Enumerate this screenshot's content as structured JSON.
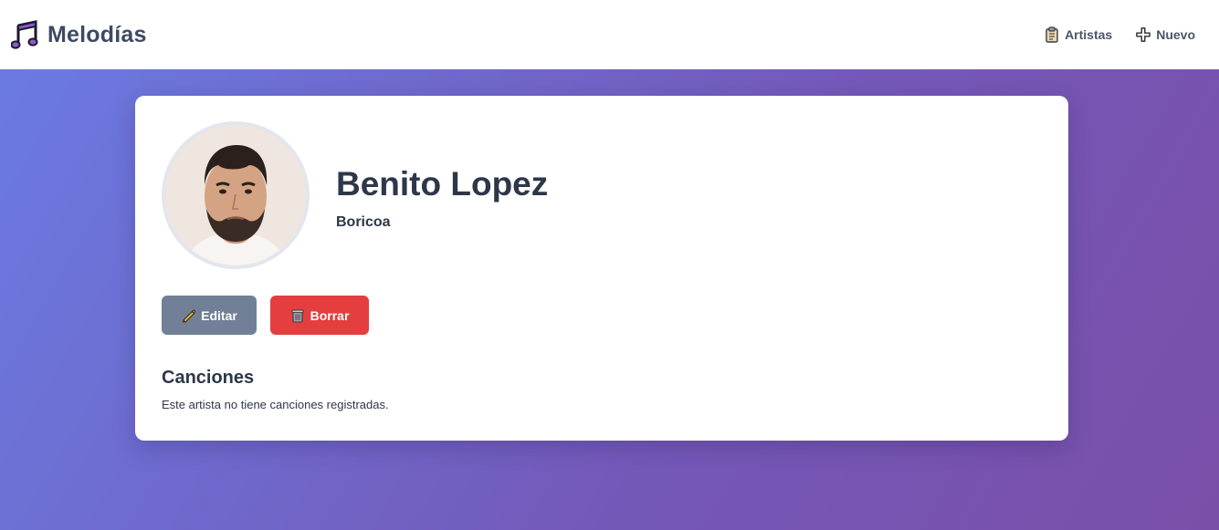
{
  "header": {
    "brand": "Melodías",
    "brand_icon": "music-notes-icon",
    "nav": [
      {
        "label": "Artistas",
        "icon": "clipboard-icon"
      },
      {
        "label": "Nuevo",
        "icon": "plus-icon"
      }
    ]
  },
  "artist": {
    "name": "Benito Lopez",
    "origin": "Boricoa"
  },
  "actions": {
    "edit_label": "Editar",
    "edit_icon": "pencil-icon",
    "delete_label": "Borrar",
    "delete_icon": "trash-icon"
  },
  "songs": {
    "title": "Canciones",
    "empty_message": "Este artista no tiene canciones registradas."
  },
  "colors": {
    "brand_text": "#3d4a63",
    "edit_button": "#718096",
    "delete_button": "#e53e3e",
    "gradient_start": "#6a7ce3",
    "gradient_end": "#7a4fa8"
  }
}
